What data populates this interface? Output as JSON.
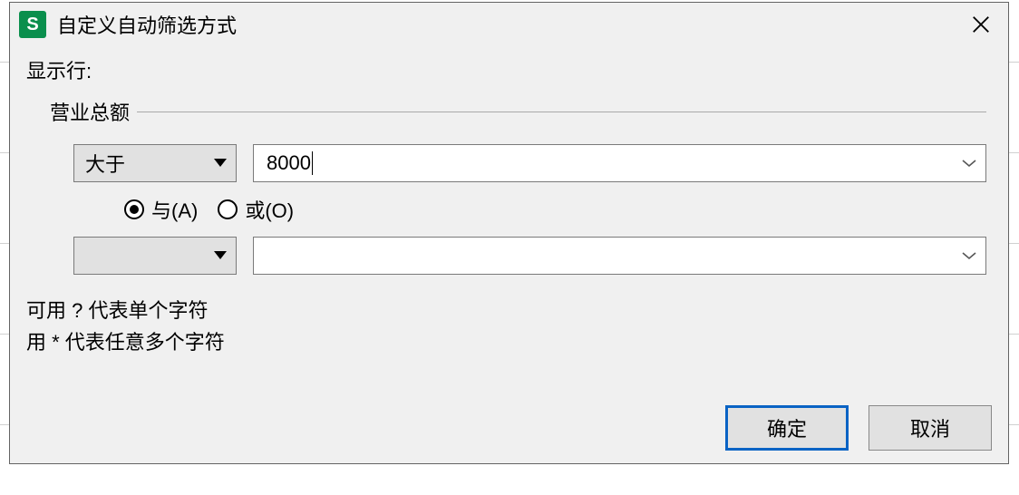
{
  "titlebar": {
    "app_icon_letter": "S",
    "title": "自定义自动筛选方式"
  },
  "body": {
    "show_rows_label": "显示行:",
    "field_label": "营业总额",
    "criteria": [
      {
        "operator": "大于",
        "value": "8000"
      },
      {
        "operator": "",
        "value": ""
      }
    ],
    "logic": {
      "and_label": "与(A)",
      "or_label": "或(O)",
      "selected": "and"
    },
    "hints": {
      "line1": "可用 ? 代表单个字符",
      "line2": "用 * 代表任意多个字符"
    }
  },
  "footer": {
    "ok_label": "确定",
    "cancel_label": "取消"
  }
}
